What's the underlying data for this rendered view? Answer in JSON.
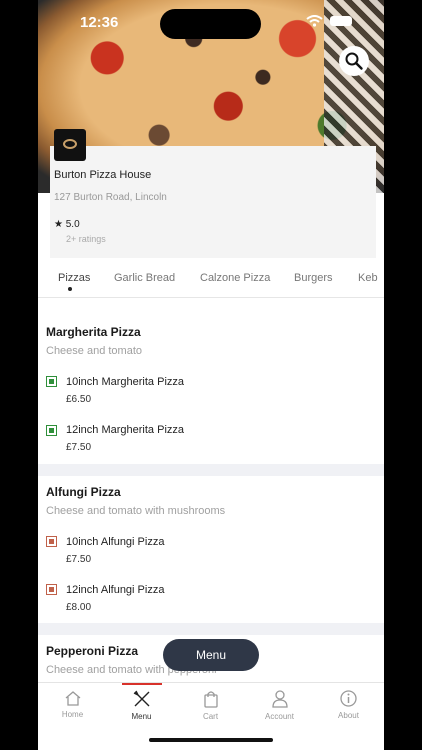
{
  "status_bar": {
    "time": "12:36"
  },
  "restaurant": {
    "name": "Burton Pizza House",
    "address": "127 Burton Road, Lincoln",
    "rating": "5.0",
    "ratings_count": "2+ ratings",
    "logo_text": "BURTON PIZZA HOUSE"
  },
  "tabs": [
    {
      "label": "Pizzas",
      "active": true
    },
    {
      "label": "Garlic Bread"
    },
    {
      "label": "Calzone Pizza"
    },
    {
      "label": "Burgers"
    },
    {
      "label": "Keb"
    }
  ],
  "sections": [
    {
      "title": "Margherita Pizza",
      "description": "Cheese and tomato",
      "items": [
        {
          "name": "10inch Margherita Pizza",
          "price": "£6.50",
          "type": "veg"
        },
        {
          "name": "12inch Margherita Pizza",
          "price": "£7.50",
          "type": "veg"
        }
      ]
    },
    {
      "title": "Alfungi Pizza",
      "description": "Cheese and tomato with mushrooms",
      "items": [
        {
          "name": "10inch Alfungi Pizza",
          "price": "£7.50",
          "type": "nonveg"
        },
        {
          "name": "12inch Alfungi Pizza",
          "price": "£8.00",
          "type": "nonveg"
        }
      ]
    },
    {
      "title": "Pepperoni Pizza",
      "description": "Cheese and tomato with pepperoni",
      "items": []
    }
  ],
  "floating_button": {
    "label": "Menu"
  },
  "bottom_nav": [
    {
      "label": "Home",
      "icon": "home-icon"
    },
    {
      "label": "Menu",
      "icon": "fork-knife-icon",
      "active": true
    },
    {
      "label": "Cart",
      "icon": "bag-icon"
    },
    {
      "label": "Account",
      "icon": "user-icon"
    },
    {
      "label": "About",
      "icon": "info-icon"
    }
  ],
  "colors": {
    "accent": "#d8322b",
    "veg": "#2f8f3a",
    "nonveg": "#c0614a",
    "menu_button": "#2f3747"
  }
}
